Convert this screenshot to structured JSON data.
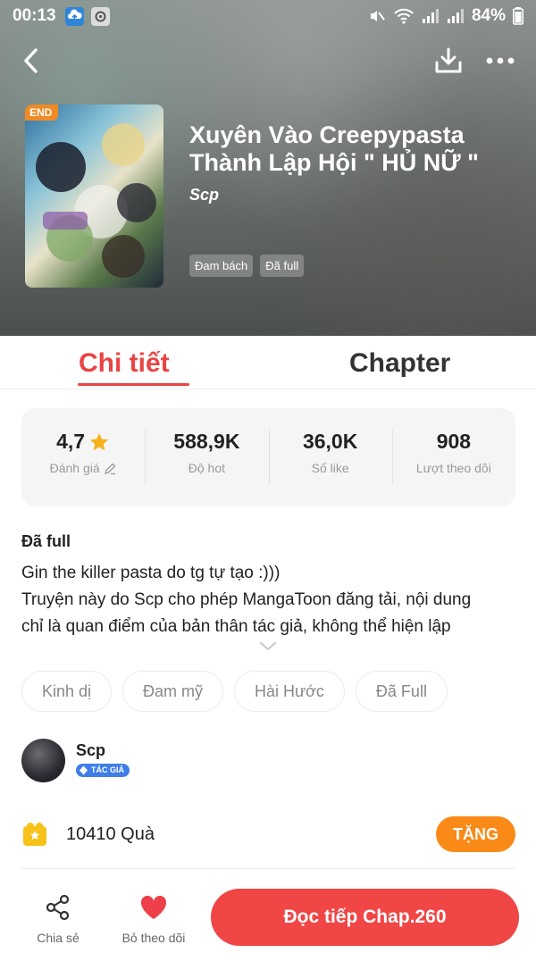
{
  "status_bar": {
    "time": "00:13",
    "battery": "84%",
    "icons": [
      "cloud-upload-icon",
      "media-app-icon",
      "mute-icon",
      "wifi-icon",
      "signal-icon",
      "signal-icon"
    ]
  },
  "nav": {
    "back_icon": "chevron-left-icon",
    "download_icon": "download-icon",
    "more_icon": "more-dots-icon"
  },
  "book": {
    "cover_badge": "END",
    "title": "Xuyên Vào Creepypasta Thành Lập Hội \" HỦ NỮ \"",
    "author": "Scp",
    "tags": [
      "Đam bách",
      "Đã full"
    ]
  },
  "tabs": [
    {
      "label": "Chi tiết",
      "active": true
    },
    {
      "label": "Chapter",
      "active": false
    }
  ],
  "stats": [
    {
      "value": "4,7",
      "label": "Đánh giá",
      "value_icon": "star-icon",
      "label_icon": "edit-icon"
    },
    {
      "value": "588,9K",
      "label": "Độ hot"
    },
    {
      "value": "36,0K",
      "label": "Số like"
    },
    {
      "value": "908",
      "label": "Lượt theo dõi"
    }
  ],
  "description": {
    "status": "Đã full",
    "lines": [
      "Gin the killer pasta do tg tự tạo :)))",
      "Truyện này do Scp cho phép MangaToon đăng tải, nội dung",
      "chỉ là quan điểm của bản thân tác giả, không thể hiện lập"
    ]
  },
  "genres": [
    "Kinh dị",
    "Đam mỹ",
    "Hài Hước",
    "Đã Full"
  ],
  "author_section": {
    "name": "Scp",
    "badge": "TÁC GIẢ"
  },
  "gift": {
    "count_text": "10410 Quà",
    "button_label": "TẶNG"
  },
  "bottom_bar": {
    "share_label": "Chia sẻ",
    "follow_label": "Bỏ theo dõi",
    "read_label": "Đọc tiếp Chap.260"
  },
  "colors": {
    "accent_red": "#e94545",
    "read_button": "#f04646",
    "gift_button": "#fa8a18",
    "star": "#f5b21b",
    "author_badge": "#3f7ee8"
  }
}
